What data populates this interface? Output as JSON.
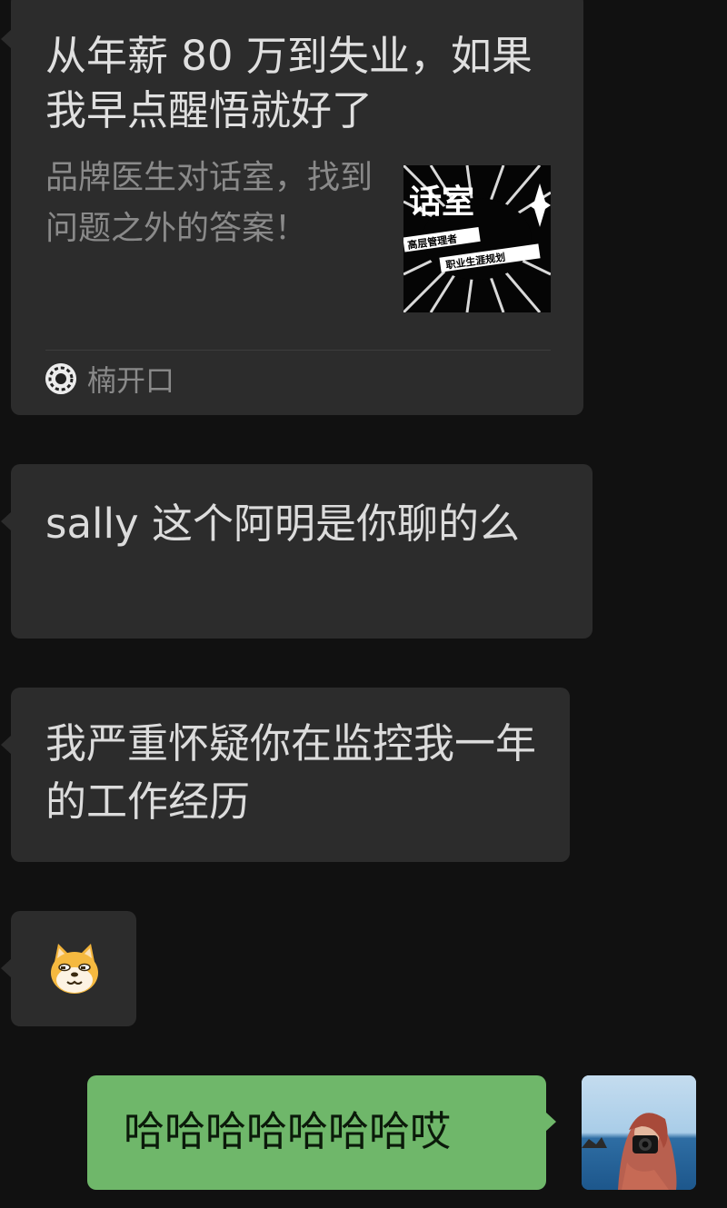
{
  "chat": {
    "link_card": {
      "title": "从年薪 80 万到失业，如果我早点醒悟就好了",
      "description": "品牌医生对话室，找到问题之外的答案！",
      "thumbnail": {
        "big_text": "话室",
        "tag_top": "高层管理者",
        "tag_bottom": "职业生涯规划"
      },
      "source_name": "楠开口"
    },
    "messages": [
      {
        "side": "left",
        "text": "sally  这个阿明是你聊的么"
      },
      {
        "side": "left",
        "text": "我严重怀疑你在监控我一年的工作经历"
      },
      {
        "side": "left",
        "type": "emoji",
        "emoji": "doge-emoji"
      },
      {
        "side": "right",
        "text": "哈哈哈哈哈哈哈哎"
      }
    ]
  },
  "colors": {
    "background": "#111111",
    "incoming_bubble": "#2c2c2c",
    "outgoing_bubble": "#6fb76a"
  }
}
